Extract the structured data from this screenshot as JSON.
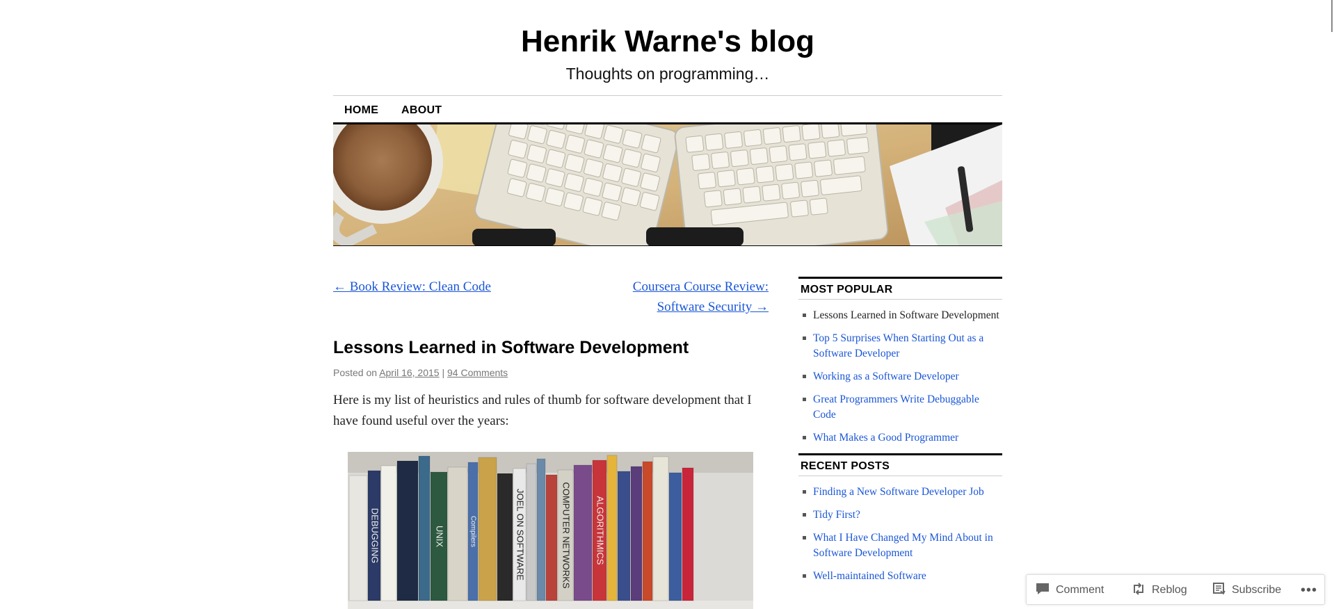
{
  "site": {
    "title": "Henrik Warne's blog",
    "description": "Thoughts on programming…"
  },
  "nav": {
    "home": "HOME",
    "about": "ABOUT"
  },
  "post_nav": {
    "prev": "← Book Review: Clean Code",
    "next_line1": "Coursera Course Review:",
    "next_line2": "Software Security →"
  },
  "post": {
    "title": "Lessons Learned in Software Development",
    "posted_on": "Posted on",
    "date": "April 16, 2015",
    "separator": "|",
    "comments": "94 Comments",
    "intro": "Here is my list of heuristics and rules of thumb for software development that I have found useful over the years:"
  },
  "sidebar": {
    "most_popular": {
      "title": "MOST POPULAR",
      "items": [
        "Lessons Learned in Software Development",
        "Top 5 Surprises When Starting Out as a Software Developer",
        "Working as a Software Developer",
        "Great Programmers Write Debuggable Code",
        "What Makes a Good Programmer"
      ]
    },
    "recent_posts": {
      "title": "RECENT POSTS",
      "items": [
        "Finding a New Software Developer Job",
        "Tidy First?",
        "What I Have Changed My Mind About in Software Development",
        "Well-maintained Software"
      ]
    }
  },
  "actionbar": {
    "comment": "Comment",
    "reblog": "Reblog",
    "subscribe": "Subscribe",
    "more": "•••"
  },
  "book_spines": [
    "DEBUGGING",
    "UNIX",
    "Compilers",
    "JOEL ON SOFTWARE",
    "COMPUTER NETWORKS",
    "ALGORITHMICS"
  ],
  "colors": {
    "link": "#1a56d6",
    "text": "#222222",
    "meta": "#777777"
  }
}
